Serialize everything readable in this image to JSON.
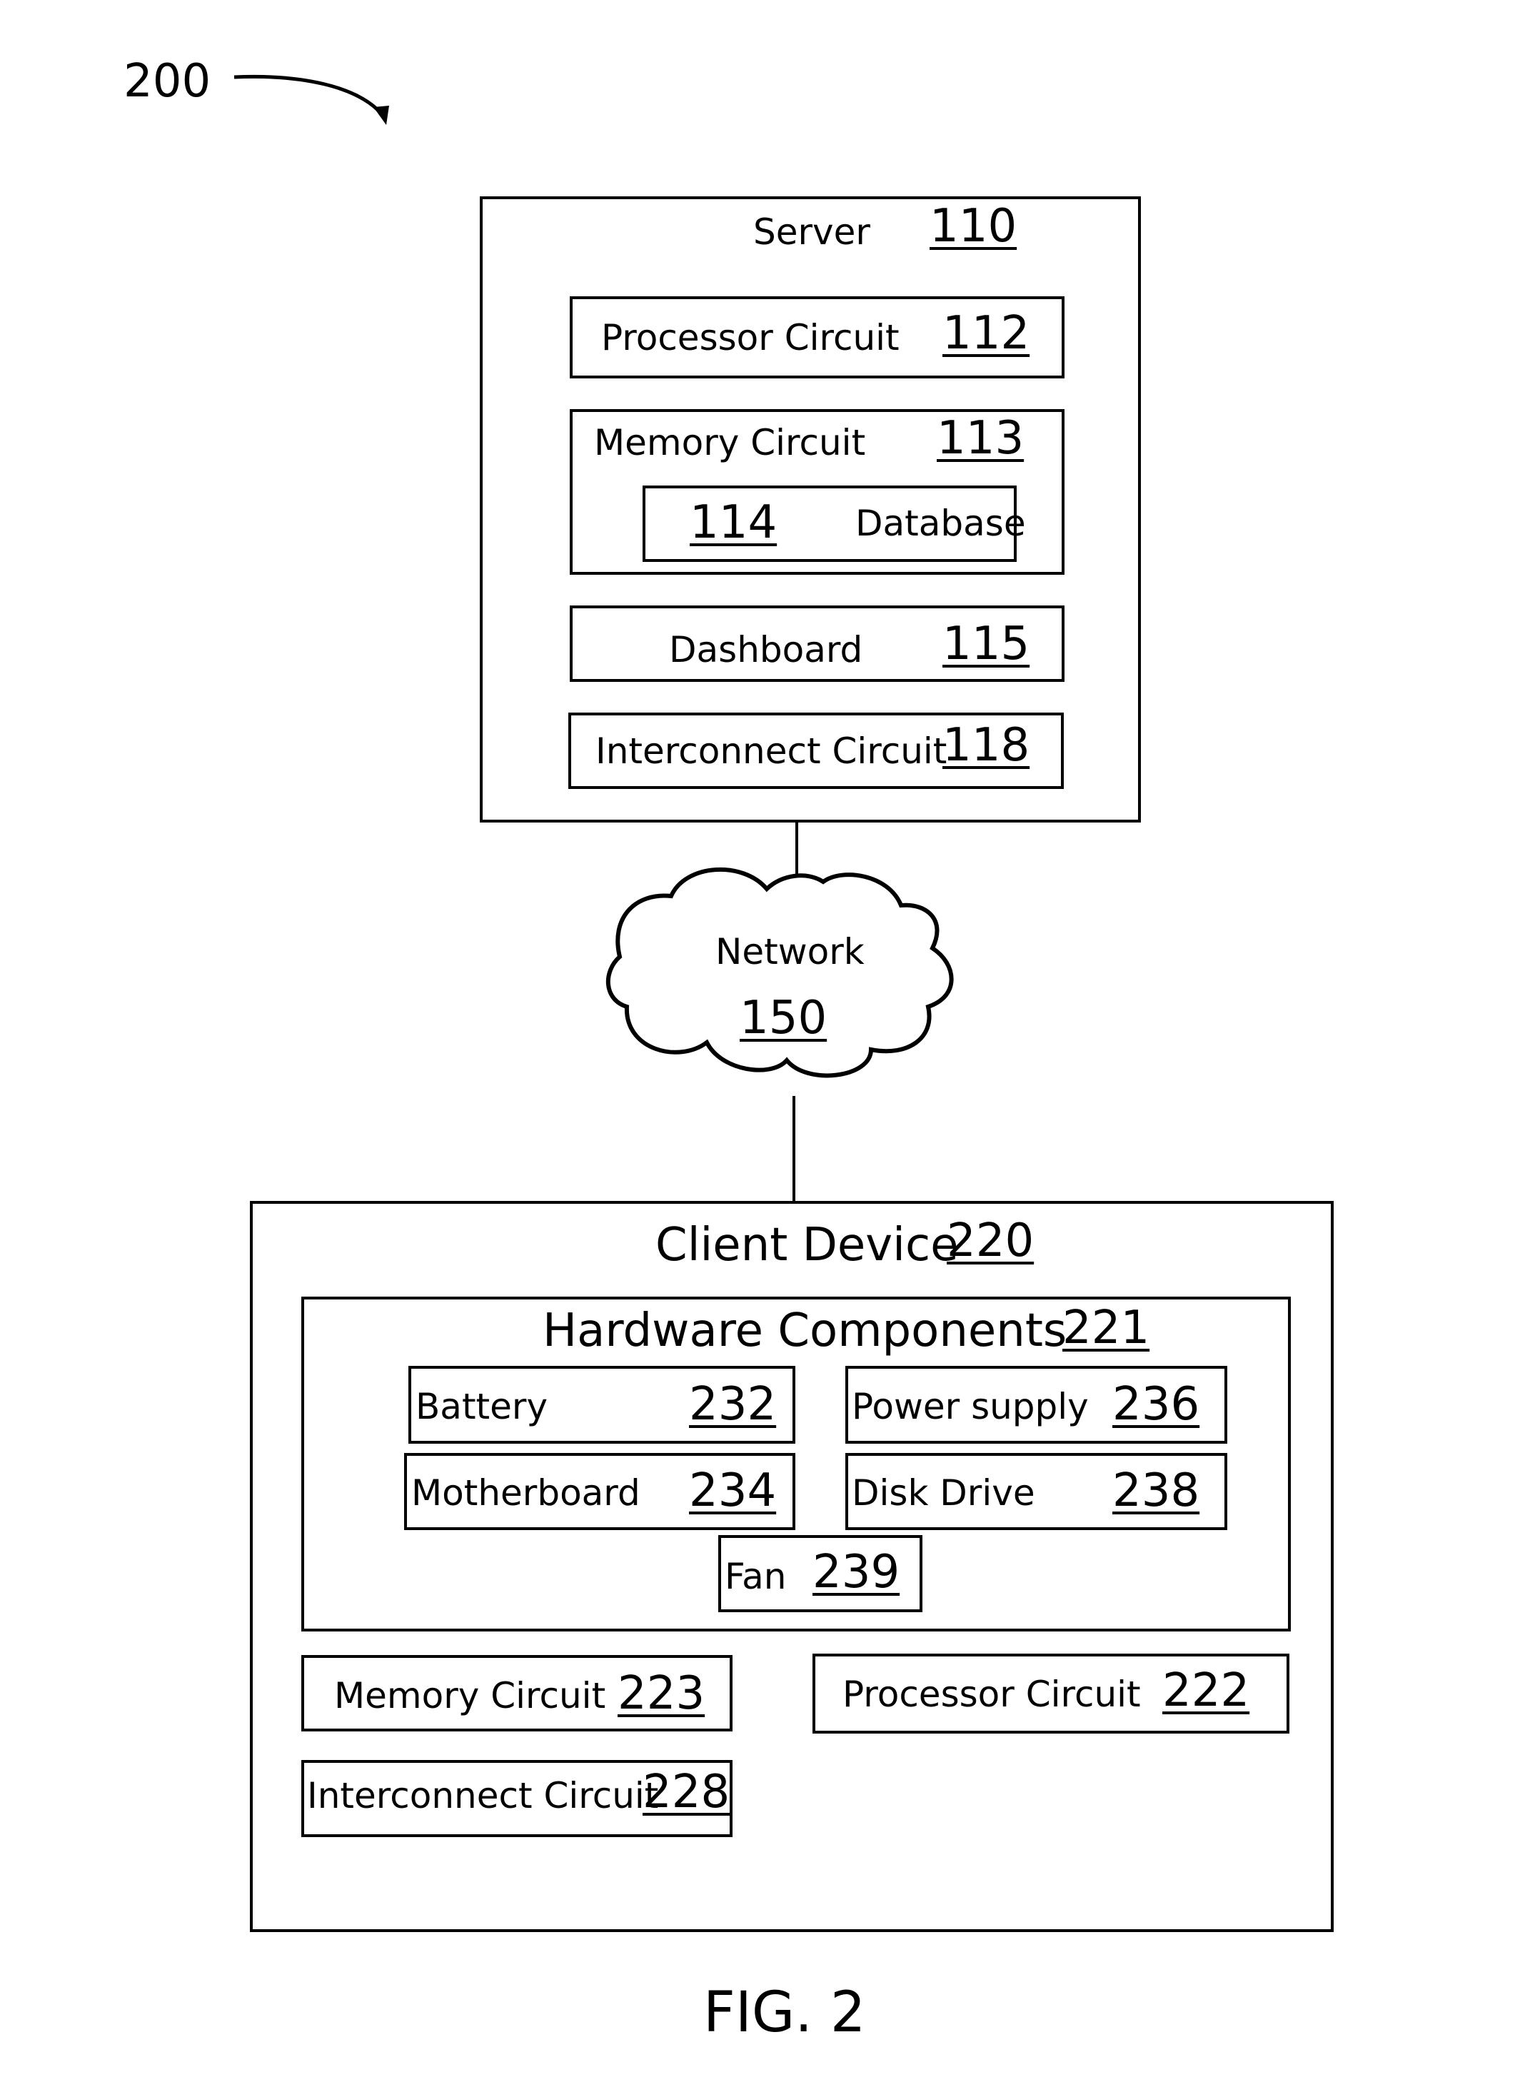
{
  "figure_ref": "200",
  "caption": "FIG. 2",
  "server": {
    "title": "Server",
    "ref": "110",
    "components": {
      "processor": {
        "label": "Processor Circuit",
        "ref": "112"
      },
      "memory": {
        "label": "Memory Circuit",
        "ref": "113"
      },
      "database": {
        "label": "Database",
        "ref": "114"
      },
      "dashboard": {
        "label": "Dashboard",
        "ref": "115"
      },
      "interconnect": {
        "label": "Interconnect Circuit",
        "ref": "118"
      }
    }
  },
  "network": {
    "label": "Network",
    "ref": "150",
    "icon": "cloud-icon"
  },
  "client": {
    "title": "Client Device",
    "ref": "220",
    "hardware": {
      "title": "Hardware Components",
      "ref": "221",
      "items": {
        "battery": {
          "label": "Battery",
          "ref": "232"
        },
        "power_supply": {
          "label": "Power supply",
          "ref": "236"
        },
        "motherboard": {
          "label": "Motherboard",
          "ref": "234"
        },
        "disk_drive": {
          "label": "Disk Drive",
          "ref": "238"
        },
        "fan": {
          "label": "Fan",
          "ref": "239"
        }
      }
    },
    "memory": {
      "label": "Memory Circuit",
      "ref": "223"
    },
    "processor": {
      "label": "Processor Circuit",
      "ref": "222"
    },
    "interconnect": {
      "label": "Interconnect Circuit",
      "ref": "228"
    }
  }
}
